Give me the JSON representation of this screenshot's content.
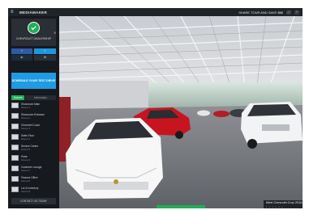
{
  "topbar": {
    "menu_icon": "menu-icon",
    "logo_text": "MEDIAMAKER",
    "right_text": "SHARE TOUR AND SAVE $$$",
    "icon_a": "fullscreen-icon",
    "icon_b": "help-icon"
  },
  "sidebar": {
    "brand_name": "CHEVROLET DEALERSHIP",
    "close_label": "✕",
    "social": {
      "facebook": "f",
      "twitter": "t",
      "linkedin": "in",
      "email": "✉"
    },
    "cta_label": "SCHEDULE YOUR TEST DRIVE",
    "tabs": [
      "Scenes",
      "Information"
    ],
    "scenes": [
      {
        "label": "Showroom Main",
        "sub": "Scene 1"
      },
      {
        "label": "Showroom Entrance",
        "sub": "Scene 2"
      },
      {
        "label": "Chevrolet Cruze",
        "sub": "Scene 3"
      },
      {
        "label": "Sales Floor",
        "sub": "Scene 4"
      },
      {
        "label": "Service Center",
        "sub": "Scene 5"
      },
      {
        "label": "Parts",
        "sub": "Scene 6"
      },
      {
        "label": "Customer Lounge",
        "sub": "Scene 7"
      },
      {
        "label": "Finance Office",
        "sub": "Scene 8"
      },
      {
        "label": "Lot & Inventory",
        "sub": "Scene 9"
      }
    ],
    "footer_label": "CONTACT US TODAY"
  },
  "viewer": {
    "caption": "Meet Chevrolet Cruz 2016",
    "dots": "• • • • • •"
  },
  "colors": {
    "accent": "#1fae5b",
    "cta": "#1e9be3",
    "sidebar_bg": "#16191e"
  }
}
